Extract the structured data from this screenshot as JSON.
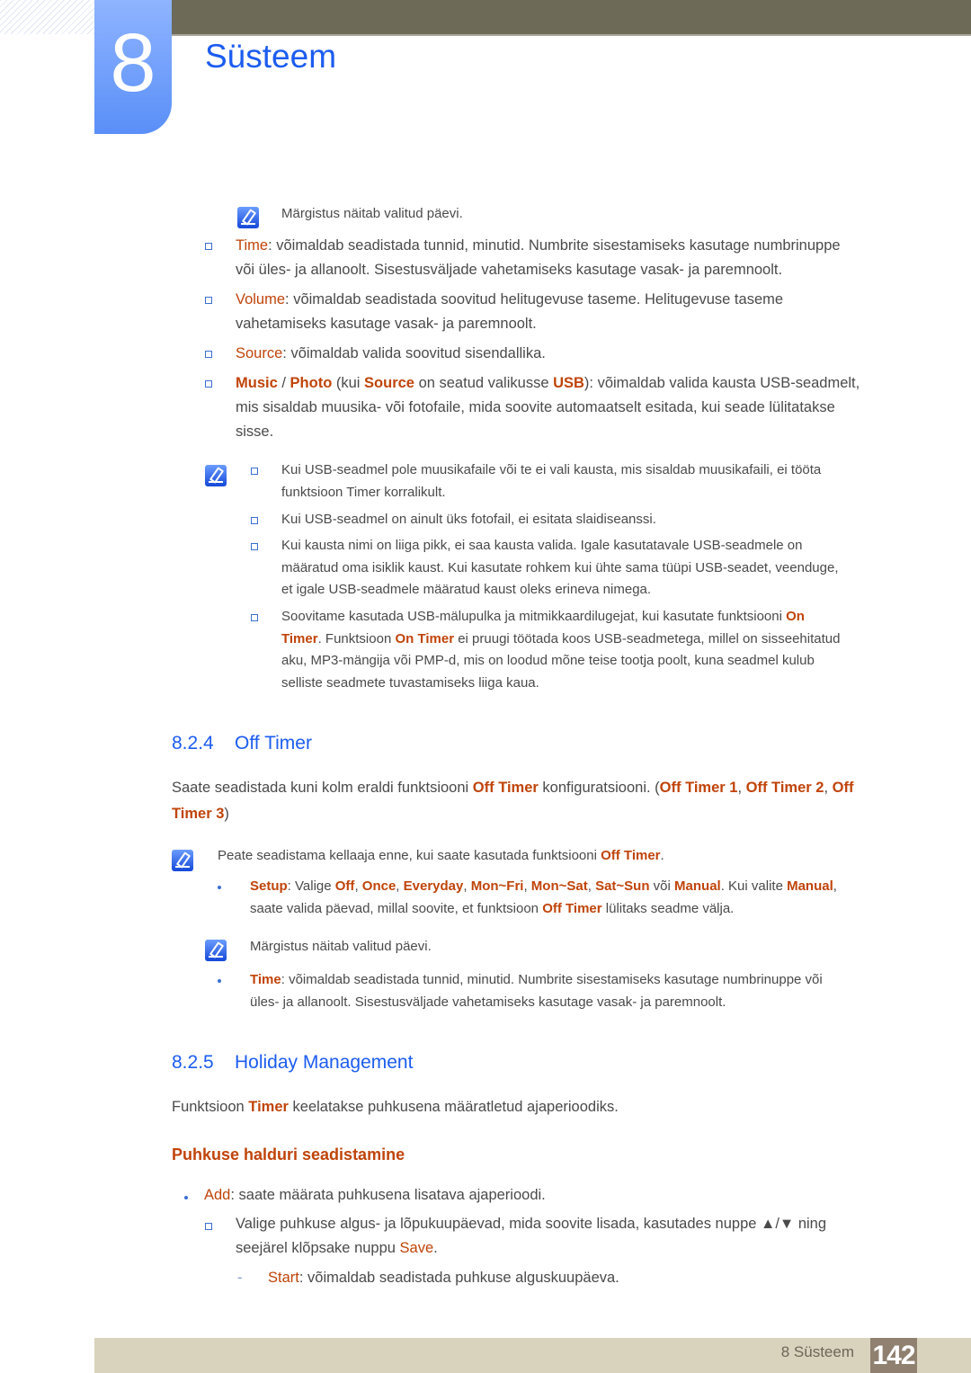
{
  "header": {
    "chapter_number": "8",
    "chapter_title": "Süsteem"
  },
  "colors": {
    "accent_blue": "#1c5cf0",
    "highlight_orange": "#c0440a",
    "header_bar": "#6d6b58",
    "footer_bar": "#d9d3bd",
    "page_badge": "#8f8070"
  },
  "top": {
    "note1": "Märgistus näitab valitud päevi.",
    "time": {
      "term": "Time",
      "l1": ": võimaldab seadistada tunnid, minutid. Numbrite sisestamiseks kasutage numbrinuppe",
      "l2": "või üles- ja allanoolt. Sisestusväljade vahetamiseks kasutage vasak- ja paremnoolt."
    },
    "volume": {
      "term": "Volume",
      "l1": ": võimaldab seadistada soovitud helitugevuse taseme. Helitugevuse taseme",
      "l2": "vahetamiseks kasutage vasak- ja paremnoolt."
    },
    "source": {
      "term": "Source",
      "l1": ": võimaldab valida soovitud sisendallika."
    },
    "music": {
      "music": "Music",
      "slash": " / ",
      "photo": "Photo",
      "kui": " (kui ",
      "source": "Source",
      "seatud": " on seatud valikusse ",
      "usb": "USB",
      "l1rest": "): võimaldab valida kausta USB-seadmelt,",
      "l2": "mis sisaldab muusika- või fotofaile, mida soovite automaatselt esitada, kui seade lülitatakse",
      "l3": "sisse."
    },
    "notes": [
      {
        "l1": "Kui USB-seadmel pole muusikafaile või te ei vali kausta, mis sisaldab muusikafaili, ei tööta",
        "l2": "funktsioon Timer korralikult."
      },
      {
        "l1": "Kui USB-seadmel on ainult üks fotofail, ei esitata slaidiseanssi."
      },
      {
        "l1": "Kui kausta nimi on liiga pikk, ei saa kausta valida. Igale kasutatavale USB-seadmele on",
        "l2": "määratud oma isiklik kaust. Kui kasutate rohkem kui ühte sama tüüpi USB-seadet, veenduge,",
        "l3": "et igale USB-seadmele määratud kaust oleks erineva nimega."
      },
      {
        "l1a": "Soovitame kasutada USB-mälupulka ja mitmikkaardilugejat, kui kasutate funktsiooni ",
        "l1b": "On",
        "l2a": "Timer",
        "l2b": ". Funktsioon ",
        "l2c": "On Timer",
        "l2d": " ei pruugi töötada koos USB-seadmetega, millel on sisseehitatud",
        "l3": "aku, MP3-mängija või PMP-d, mis on loodud mõne teise tootja poolt, kuna seadmel kulub",
        "l4": "selliste seadmete tuvastamiseks liiga kaua."
      }
    ]
  },
  "off_timer": {
    "number": "8.2.4",
    "title": "Off Timer",
    "p1a": "Saate seadistada kuni kolm eraldi funktsiooni ",
    "p1b": "Off Timer",
    "p1c": " konfiguratsiooni. (",
    "p1d": "Off Timer 1",
    "p1e": ", ",
    "p1f": "Off Timer 2",
    "p1g": ", ",
    "p1h": "Off",
    "p2a": "Timer 3",
    "p2b": ")",
    "note_a": "Peate seadistama kellaaja enne, kui saate kasutada funktsiooni ",
    "note_b": "Off Timer",
    "note_c": ".",
    "setup": {
      "term": "Setup",
      "t1": ": Valige ",
      "o1": "Off",
      "c1": ", ",
      "o2": "Once",
      "c2": ", ",
      "o3": "Everyday",
      "c3": ", ",
      "o4": "Mon~Fri",
      "c4": ", ",
      "o5": "Mon~Sat",
      "c5": ", ",
      "o6": "Sat~Sun",
      "c6": " või ",
      "o7": "Manual",
      "c7": ". Kui valite ",
      "o8": "Manual",
      "c8": ",",
      "l2a": "saate valida päevad, millal soovite, et funktsioon ",
      "l2b": "Off Timer",
      "l2c": " lülitaks seadme välja."
    },
    "note2": "Märgistus näitab valitud päevi.",
    "time": {
      "term": "Time",
      "l1": ": võimaldab seadistada tunnid, minutid. Numbrite sisestamiseks kasutage numbrinuppe või",
      "l2": "üles- ja allanoolt. Sisestusväljade vahetamiseks kasutage vasak- ja paremnoolt."
    }
  },
  "holiday": {
    "number": "8.2.5",
    "title": "Holiday Management",
    "p_a": "Funktsioon ",
    "p_b": "Timer",
    "p_c": " keelatakse puhkusena määratletud ajaperioodiks.",
    "subheading": "Puhkuse halduri seadistamine",
    "add": {
      "term": "Add",
      "text": ": saate määrata puhkusena lisatava ajaperioodi."
    },
    "select": {
      "l1": "Valige puhkuse algus- ja lõpukuupäevad, mida soovite lisada, kasutades nuppe ▲/▼ ning",
      "l2a": "seejärel klõpsake nuppu ",
      "l2b": "Save",
      "l2c": "."
    },
    "start": {
      "dash": "-",
      "term": "Start",
      "text": ": võimaldab seadistada puhkuse alguskuupäeva."
    }
  },
  "footer": {
    "label": "8 Süsteem",
    "page": "142"
  }
}
